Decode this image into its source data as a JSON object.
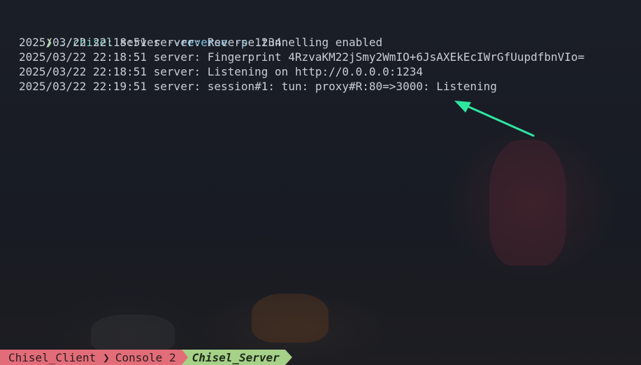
{
  "terminal": {
    "prompt_symbol": "❯",
    "command": "./chisel",
    "subcommand": "server",
    "flag_reverse": "--reverse",
    "flag_port": "-p",
    "port_value": "1234",
    "log_lines": [
      "2025/03/22 22:18:51 server: Reverse tunnelling enabled",
      "2025/03/22 22:18:51 server: Fingerprint 4RzvaKM22jSmy2WmIO+6JsAXEkEcIWrGfUupdfbnVIo=",
      "2025/03/22 22:18:51 server: Listening on http://0.0.0.0:1234",
      "2025/03/22 22:19:51 server: session#1: tun: proxy#R:80=>3000: Listening"
    ]
  },
  "annotation": {
    "arrow_color": "#2ee6a0",
    "arrow_icon": "pointer-arrow-icon"
  },
  "statusbar": {
    "tabs": [
      {
        "label": "Chisel_Client",
        "active": false,
        "color": "#e26d78"
      },
      {
        "label": "Console 2",
        "active": false,
        "color": "#e26d78"
      },
      {
        "label": "Chisel_Server",
        "active": true,
        "color": "#a6d189"
      }
    ]
  }
}
